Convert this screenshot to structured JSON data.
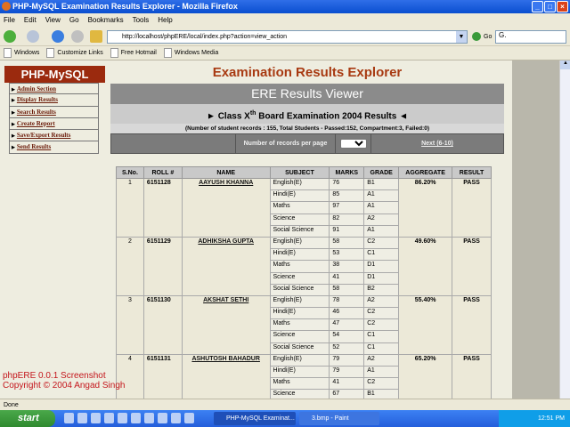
{
  "window": {
    "title": "PHP-MySQL Examination Results Explorer - Mozilla Firefox"
  },
  "menu": [
    "File",
    "Edit",
    "View",
    "Go",
    "Bookmarks",
    "Tools",
    "Help"
  ],
  "nav": {
    "url": "http://localhost/phpERE/local/index.php?action=view_action",
    "go_label": "Go",
    "search_value": "G."
  },
  "bookmarks": [
    "Windows",
    "Customize Links",
    "Free Hotmail",
    "Windows Media"
  ],
  "sidebar": {
    "logo": "PHP-MySQL",
    "items": [
      "Admin Section",
      "Display Results",
      "Search Results",
      "Create Report",
      "Save/Export Results",
      "Send Results"
    ]
  },
  "main": {
    "title": "Examination Results Explorer",
    "viewer_title": "ERE Results Viewer",
    "heading_pre": "Class X",
    "heading_sup": "th",
    "heading_post": " Board Examination 2004 Results",
    "stats": "(Number of student records : 155, Total Students - Passed:152, Compartment:3, Failed:0)",
    "per_page_label": "Number of records per page",
    "per_page_value": "",
    "next_link": "Next (6-10)"
  },
  "table": {
    "headers": [
      "S.No.",
      "ROLL #",
      "NAME",
      "SUBJECT",
      "MARKS",
      "GRADE",
      "AGGREGATE",
      "RESULT"
    ],
    "students": [
      {
        "sno": "1",
        "roll": "6151128",
        "name": "AAYUSH KHANNA",
        "aggregate": "86.20%",
        "result": "PASS",
        "subjects": [
          [
            "English(E)",
            "76",
            "B1"
          ],
          [
            "Hindi(E)",
            "85",
            "A1"
          ],
          [
            "Maths",
            "97",
            "A1"
          ],
          [
            "Science",
            "82",
            "A2"
          ],
          [
            "Social Science",
            "91",
            "A1"
          ]
        ]
      },
      {
        "sno": "2",
        "roll": "6151129",
        "name": "ADHIKSHA GUPTA",
        "aggregate": "49.60%",
        "result": "PASS",
        "subjects": [
          [
            "English(E)",
            "58",
            "C2"
          ],
          [
            "Hindi(E)",
            "53",
            "C1"
          ],
          [
            "Maths",
            "38",
            "D1"
          ],
          [
            "Science",
            "41",
            "D1"
          ],
          [
            "Social Science",
            "58",
            "B2"
          ]
        ]
      },
      {
        "sno": "3",
        "roll": "6151130",
        "name": "AKSHAT SETHI",
        "aggregate": "55.40%",
        "result": "PASS",
        "subjects": [
          [
            "English(E)",
            "78",
            "A2"
          ],
          [
            "Hindi(E)",
            "46",
            "C2"
          ],
          [
            "Maths",
            "47",
            "C2"
          ],
          [
            "Science",
            "54",
            "C1"
          ],
          [
            "Social Science",
            "52",
            "C1"
          ]
        ]
      },
      {
        "sno": "4",
        "roll": "6151131",
        "name": "ASHUTOSH BAHADUR",
        "aggregate": "65.20%",
        "result": "PASS",
        "subjects": [
          [
            "English(E)",
            "79",
            "A2"
          ],
          [
            "Hindi(E)",
            "79",
            "A1"
          ],
          [
            "Maths",
            "41",
            "C2"
          ],
          [
            "Science",
            "67",
            "B1"
          ]
        ]
      }
    ]
  },
  "footer": {
    "line1": "phpERE 0.0.1 Screenshot",
    "line2": "Copyright © 2004 Angad Singh"
  },
  "status": "Done",
  "taskbar": {
    "start": "start",
    "tasks": [
      "PHP-MySQL Examinat...",
      "3.bmp - Paint"
    ],
    "clock": "12:51 PM"
  }
}
